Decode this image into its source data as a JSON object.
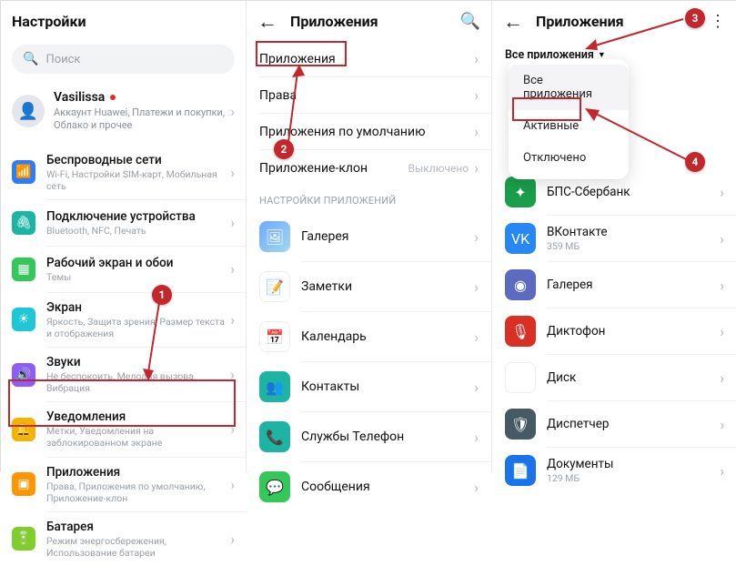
{
  "p1": {
    "title": "Настройки",
    "search_placeholder": "Поиск",
    "account": {
      "name": "Vasilissa",
      "sub": "Аккаунт Huawei, Платежи и покупки, Облако и прочее"
    },
    "items": [
      {
        "title": "Беспроводные сети",
        "sub": "Wi-Fi, Настройки SIM-карт, Мобильная сеть"
      },
      {
        "title": "Подключение устройства",
        "sub": "Bluetooth, NFC, Печать"
      },
      {
        "title": "Рабочий экран и обои",
        "sub": "Темы"
      },
      {
        "title": "Экран",
        "sub": "Яркость, Защита зрения, Размер текста и отображения"
      },
      {
        "title": "Звуки",
        "sub": "Не беспокоить, Мелодия вызова, Вибрация"
      },
      {
        "title": "Уведомления",
        "sub": "Метки, Уведомления на заблокированном экране"
      },
      {
        "title": "Приложения",
        "sub": "Права, Приложения по умолчанию, Приложение-клон"
      },
      {
        "title": "Батарея",
        "sub": "Режим энергосбережения, Использование батареи"
      }
    ]
  },
  "p2": {
    "title": "Приложения",
    "rows": [
      {
        "label": "Приложения"
      },
      {
        "label": "Права"
      },
      {
        "label": "Приложения по умолчанию"
      },
      {
        "label": "Приложение-клон",
        "value": "Выключено"
      }
    ],
    "section": "НАСТРОЙКИ ПРИЛОЖЕНИЙ",
    "apps": [
      {
        "name": "Галерея"
      },
      {
        "name": "Заметки"
      },
      {
        "name": "Календарь"
      },
      {
        "name": "Контакты"
      },
      {
        "name": "Службы Телефон"
      },
      {
        "name": "Сообщения"
      }
    ]
  },
  "p3": {
    "title": "Приложения",
    "filter": "Все приложения",
    "dropdown": [
      "Все приложения",
      "Активные",
      "Отключено"
    ],
    "apps": [
      {
        "name": "БПС-Сбербанк",
        "size": ""
      },
      {
        "name": "ВКонтакте",
        "size": "359 МБ"
      },
      {
        "name": "Галерея",
        "size": ""
      },
      {
        "name": "Диктофон",
        "size": ""
      },
      {
        "name": "Диск",
        "size": ""
      },
      {
        "name": "Диспетчер",
        "size": ""
      },
      {
        "name": "Документы",
        "size": "129 МБ"
      }
    ]
  },
  "badges": {
    "b1": "1",
    "b2": "2",
    "b3": "3",
    "b4": "4"
  }
}
